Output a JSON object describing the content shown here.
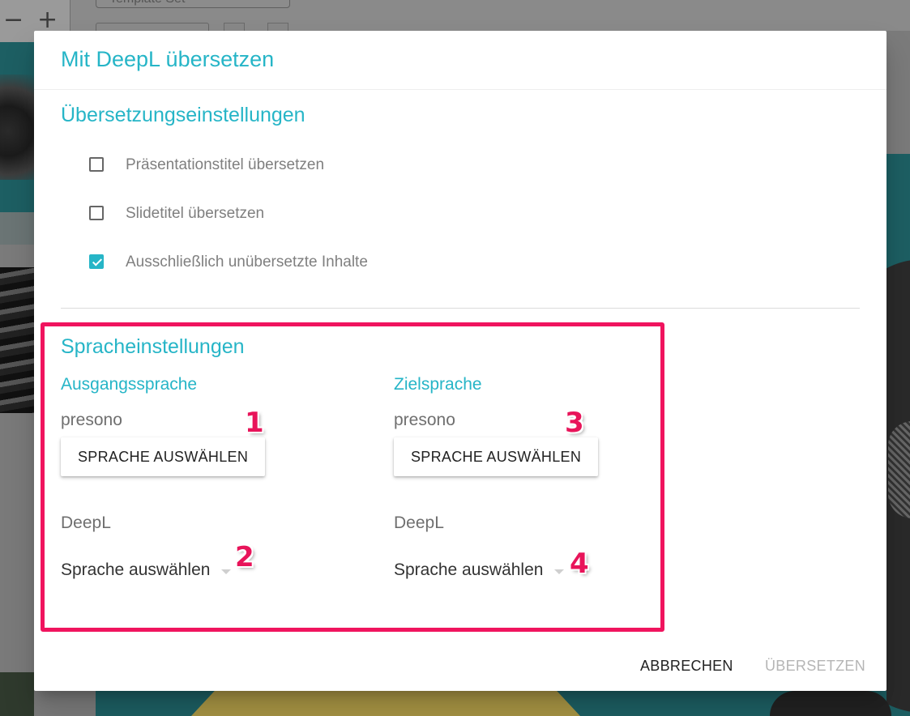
{
  "background": {
    "zoom_minus": "−",
    "zoom_plus": "+",
    "template_field": "Template Set"
  },
  "dialog": {
    "title": "Mit DeepL übersetzen",
    "translation_settings": {
      "heading": "Übersetzungseinstellungen",
      "options": [
        {
          "label": "Präsentationstitel übersetzen",
          "checked": false
        },
        {
          "label": "Slidetitel übersetzen",
          "checked": false
        },
        {
          "label": "Ausschließlich unübersetzte Inhalte",
          "checked": true
        }
      ]
    },
    "language_settings": {
      "heading": "Spracheinstellungen",
      "source": {
        "heading": "Ausgangssprache",
        "presono_label": "presono",
        "select_button": "SPRACHE AUSWÄHLEN",
        "deepl_label": "DeepL",
        "deepl_select": "Sprache auswählen"
      },
      "target": {
        "heading": "Zielsprache",
        "presono_label": "presono",
        "select_button": "SPRACHE AUSWÄHLEN",
        "deepl_label": "DeepL",
        "deepl_select": "Sprache auswählen"
      }
    },
    "actions": {
      "cancel": "ABBRECHEN",
      "translate": "ÜBERSETZEN",
      "translate_disabled": true
    }
  },
  "annotations": {
    "callouts": [
      "1",
      "2",
      "3",
      "4"
    ],
    "color": "#e8145a"
  },
  "colors": {
    "accent": "#26b5c7",
    "highlight": "#f0145e"
  }
}
